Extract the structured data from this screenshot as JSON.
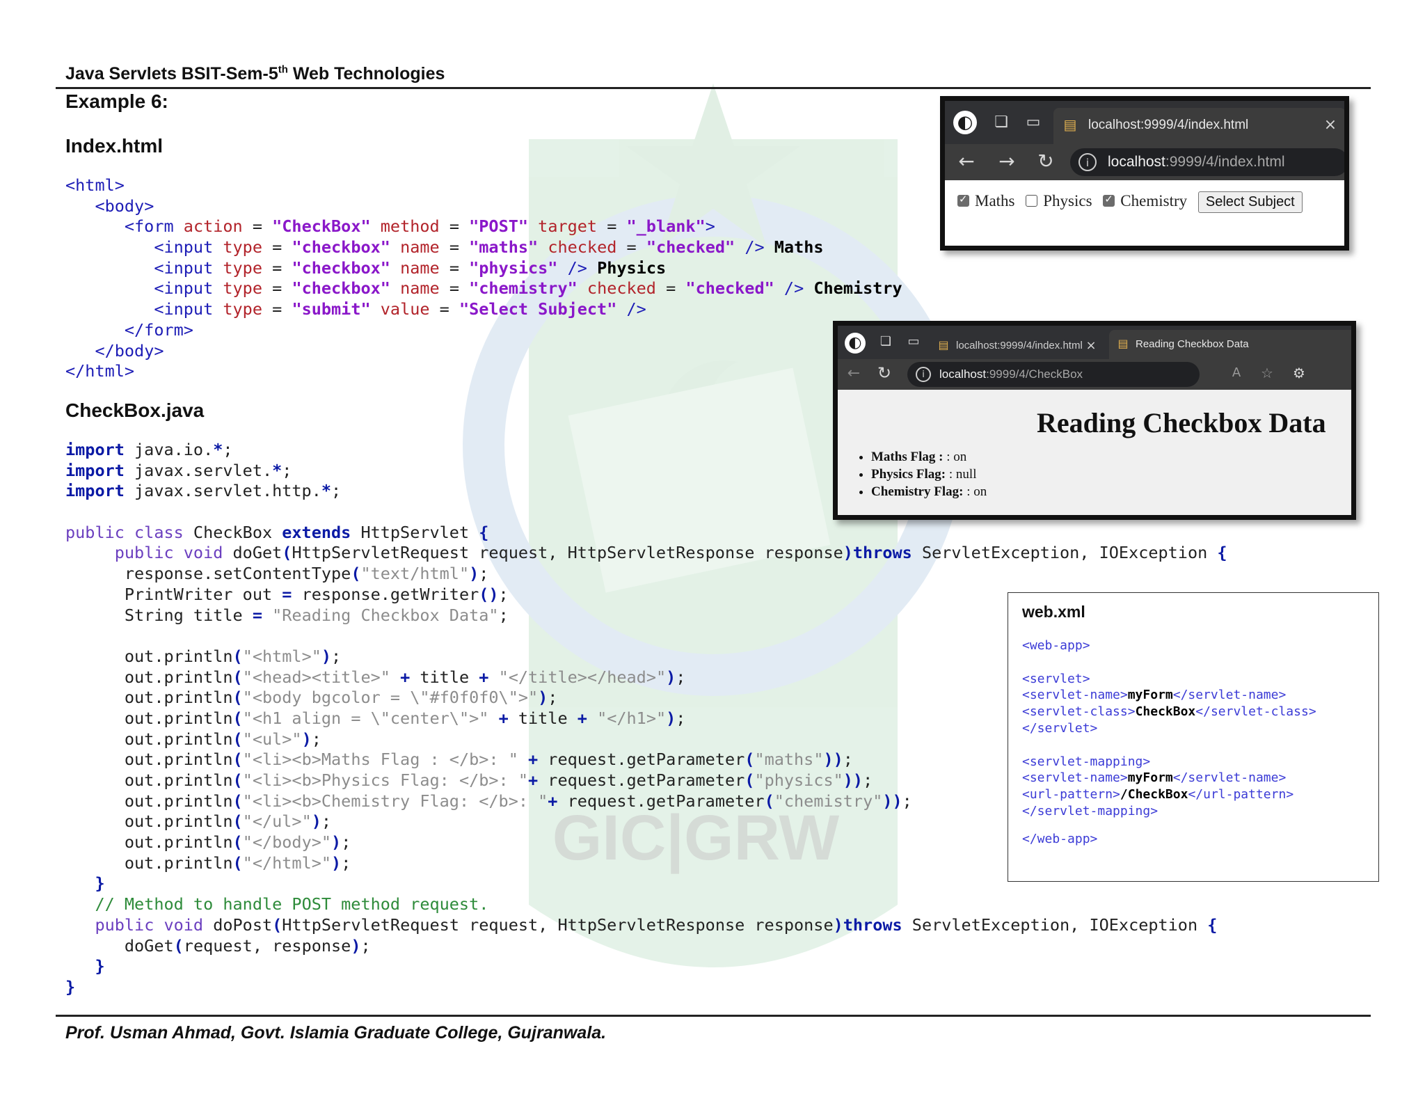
{
  "header": {
    "course_prefix": "Java Servlets BSIT-Sem-5",
    "course_sup": "th",
    "course_suffix": " Web Technologies"
  },
  "example_title": "Example 6:",
  "index_heading": "Index.html",
  "checkbox_heading": "CheckBox.java",
  "watermark_text": "GIC|GRW",
  "browser1": {
    "tab_title": "localhost:9999/4/index.html",
    "url_host": "localhost",
    "url_rest": ":9999/4/index.html",
    "checkboxes": [
      {
        "label": "Maths",
        "checked": true
      },
      {
        "label": "Physics",
        "checked": false
      },
      {
        "label": "Chemistry",
        "checked": true
      }
    ],
    "submit_label": "Select Subject"
  },
  "browser2": {
    "tab1_title": "localhost:9999/4/index.html",
    "tab2_title": "Reading Checkbox Data",
    "url_host": "localhost",
    "url_rest": ":9999/4/CheckBox",
    "page_heading": "Reading Checkbox Data",
    "items": [
      {
        "label": "Maths Flag : ",
        "value": ": on"
      },
      {
        "label": "Physics Flag: ",
        "value": ": null"
      },
      {
        "label": "Chemistry Flag: ",
        "value": ": on"
      }
    ]
  },
  "webxml": {
    "title": "web.xml",
    "app_open": "<web-app>",
    "servlet_open": "<servlet>",
    "servlet_name_open": "<servlet-name>",
    "servlet_name_value": "myForm",
    "servlet_name_close": "</servlet-name>",
    "servlet_class_open": "<servlet-class>",
    "servlet_class_value": "CheckBox",
    "servlet_class_close": "</servlet-class>",
    "servlet_close": "</servlet>",
    "mapping_open": "<servlet-mapping>",
    "url_pattern_open": "<url-pattern>",
    "url_pattern_value": "/CheckBox",
    "url_pattern_close": "</url-pattern>",
    "mapping_close": "</servlet-mapping>",
    "app_close": "</web-app>"
  },
  "footer": "Prof. Usman Ahmad, Govt. Islamia Graduate College, Gujranwala."
}
